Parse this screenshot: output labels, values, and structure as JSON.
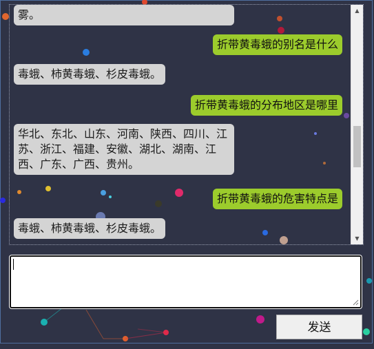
{
  "chat": {
    "messages": [
      {
        "role": "bot",
        "text": "雾。"
      },
      {
        "role": "user",
        "text": "折带黄毒蛾的别名是什么"
      },
      {
        "role": "bot",
        "text": "毒蛾、柿黄毒蛾、杉皮毒蛾。"
      },
      {
        "role": "user",
        "text": "折带黄毒蛾的分布地区是哪里"
      },
      {
        "role": "bot",
        "text": "华北、东北、山东、河南、陕西、四川、江苏、浙江、福建、安徽、湖北、湖南、江西、广东、广西、贵州。"
      },
      {
        "role": "user",
        "text": "折带黄毒蛾的危害特点是"
      },
      {
        "role": "bot",
        "text": "毒蛾、柿黄毒蛾、杉皮毒蛾。"
      }
    ]
  },
  "composer": {
    "input_value": "",
    "send_label": "发送"
  },
  "colors": {
    "background": "#2f3346",
    "bot_bubble": "#d4d4d4",
    "user_bubble": "#9ccc2c"
  }
}
